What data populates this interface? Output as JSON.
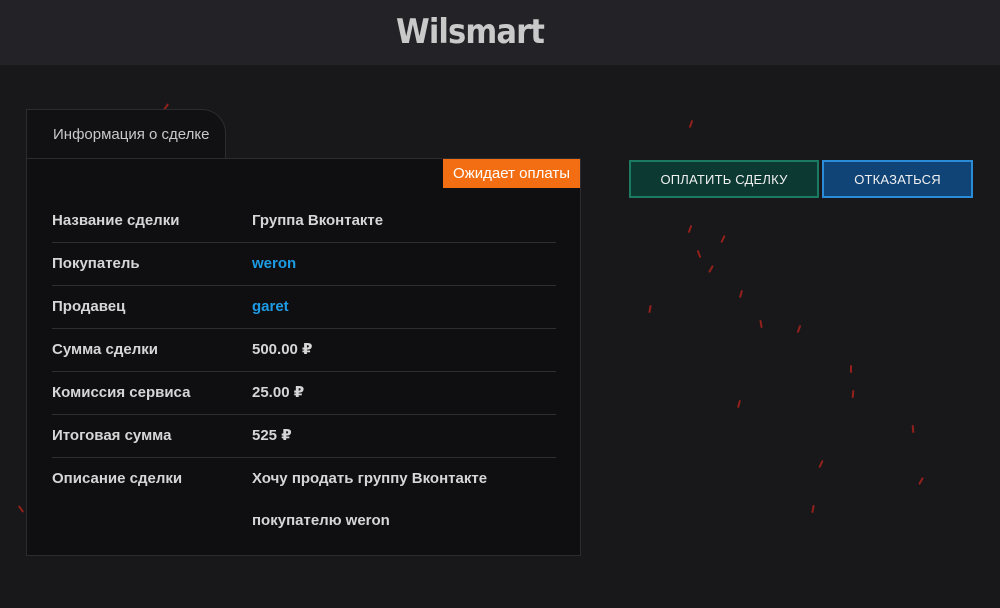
{
  "header": {
    "brand": "Wilsmart"
  },
  "deal": {
    "tab_label": "Информация о сделке",
    "status": "Ожидает оплаты",
    "rows": [
      {
        "label": "Название сделки",
        "value": "Группа Вконтакте"
      },
      {
        "label": "Покупатель",
        "value": "weron"
      },
      {
        "label": "Продавец",
        "value": "garet"
      },
      {
        "label": "Сумма сделки",
        "value": "500.00 ₽"
      },
      {
        "label": "Комиссия сервиса",
        "value": "25.00 ₽"
      },
      {
        "label": "Итоговая сумма",
        "value": "525 ₽"
      },
      {
        "label": "Описание сделки",
        "value": "Хочу продать группу Вконтакте покупателю weron"
      }
    ]
  },
  "actions": {
    "pay_label": "ОПЛАТИТЬ СДЕЛКУ",
    "refuse_label": "ОТКАЗАТЬСЯ"
  },
  "colors": {
    "accent_status": "#f36e12",
    "link": "#1e9be5",
    "pay": "#0c3a33",
    "refuse": "#114476"
  }
}
